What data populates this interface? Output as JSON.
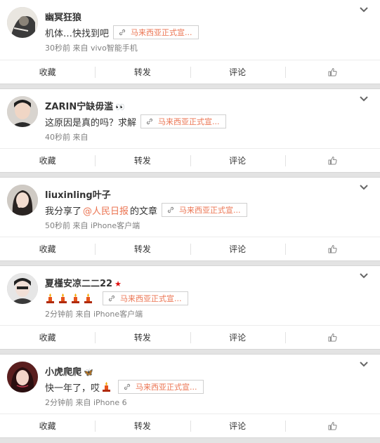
{
  "colors": {
    "accent": "#eb7350",
    "meta": "#808080",
    "text": "#333333",
    "background": "#e3e3e3"
  },
  "action_labels": {
    "favorite": "收藏",
    "repost": "转发",
    "comment": "评论"
  },
  "posts": [
    {
      "user": "幽冥狂狼",
      "badge": "",
      "content_before": "机体…快找到吧",
      "mention": "",
      "content_after": "",
      "link_text": "马来西亚正式宣...",
      "time": "30秒前",
      "source": "来自 vivo智能手机"
    },
    {
      "user": "ZARIN宁缺毋滥",
      "badge": "",
      "content_before": "这原因是真的吗？求解",
      "mention": "",
      "content_after": "",
      "link_text": "马来西亚正式宣...",
      "time": "40秒前",
      "source": "来自"
    },
    {
      "user": "liuxinling叶子",
      "badge": "",
      "content_before": "我分享了",
      "mention": "@人民日报",
      "content_after": "的文章",
      "link_text": "马来西亚正式宣...",
      "time": "50秒前",
      "source": "来自 iPhone客户端"
    },
    {
      "user": "夏槿安凉二二22",
      "badge": "★",
      "content_before": "",
      "mention": "",
      "content_after": "",
      "link_text": "马来西亚正式宣...",
      "time": "2分钟前",
      "source": "来自 iPhone客户端"
    },
    {
      "user": "小虎爬爬",
      "badge": "",
      "content_before": "快一年了，哎",
      "mention": "",
      "content_after": "",
      "link_text": "马来西亚正式宣...",
      "time": "2分钟前",
      "source": "来自 iPhone 6"
    }
  ]
}
